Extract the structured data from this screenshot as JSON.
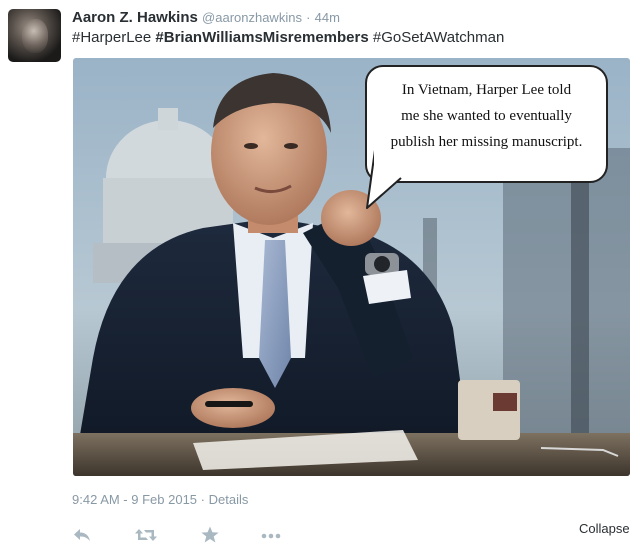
{
  "tweet": {
    "author_name": "Aaron Z. Hawkins",
    "author_handle": "@aaronzhawkins",
    "separator": "·",
    "relative_time": "44m",
    "hashtags": [
      "#HarperLee",
      "#BrianWilliamsMisremembers",
      "#GoSetAWatchman"
    ],
    "avatar_icon": "profile-photo"
  },
  "media": {
    "bubble_lines": [
      "In Vietnam, Harper Lee told",
      "me she wanted to eventually",
      "publish her missing manuscript."
    ]
  },
  "meta": {
    "timestamp": "9:42 AM - 9 Feb 2015",
    "separator": "·",
    "details_label": "Details"
  },
  "actions": {
    "icons": [
      "reply-icon",
      "retweet-icon",
      "favorite-icon",
      "more-icon"
    ],
    "collapse_label": "Collapse"
  },
  "colors": {
    "text": "#292f33",
    "muted": "#8899a6",
    "icon": "#aab8c2"
  }
}
